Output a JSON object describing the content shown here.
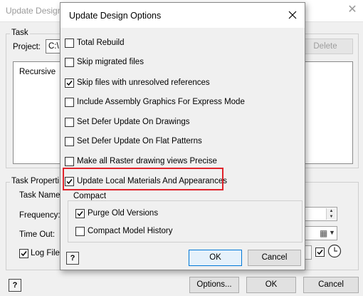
{
  "background_window": {
    "title": "Update Design",
    "task_group_label": "Task",
    "project_label": "Project:",
    "project_value": "C:\\",
    "delete_label": "Delete",
    "list_items": [
      "Recursive"
    ],
    "task_properties_label": "Task Properti",
    "task_name_label": "Task Name:",
    "frequency_label": "Frequency:",
    "time_out_label": "Time Out:",
    "log_file_label": "Log File:",
    "options_label": "Options...",
    "ok_label": "OK",
    "cancel_label": "Cancel"
  },
  "dialog": {
    "title": "Update Design Options",
    "options": [
      {
        "label": "Total Rebuild",
        "checked": false
      },
      {
        "label": "Skip migrated files",
        "checked": false
      },
      {
        "label": "Skip files with unresolved references",
        "checked": true
      },
      {
        "label": "Include Assembly Graphics For Express Mode",
        "checked": false
      },
      {
        "label": "Set Defer Update On Drawings",
        "checked": false
      },
      {
        "label": "Set Defer Update On Flat Patterns",
        "checked": false
      },
      {
        "label": "Make all Raster drawing views Precise",
        "checked": false
      },
      {
        "label": "Update Local Materials And Appearances",
        "checked": true
      }
    ],
    "compact_group": {
      "label": "Compact",
      "options": [
        {
          "label": "Purge Old Versions",
          "checked": true
        },
        {
          "label": "Compact Model History",
          "checked": false
        }
      ]
    },
    "ok_label": "OK",
    "cancel_label": "Cancel",
    "help_glyph": "?"
  },
  "colors": {
    "highlight": "#e0232b",
    "default_button_border": "#0078d7"
  }
}
